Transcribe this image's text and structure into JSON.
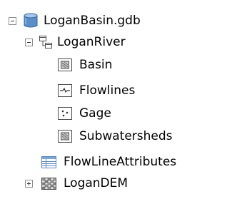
{
  "tree": {
    "root": {
      "label": "LoganBasin.gdb",
      "icon": "database-icon",
      "state": "expanded"
    },
    "dataset": {
      "label": "LoganRiver",
      "icon": "feature-dataset-icon",
      "state": "expanded"
    },
    "feature_classes": [
      {
        "label": "Basin",
        "icon": "polygon-feature-class-icon"
      },
      {
        "label": "Flowlines",
        "icon": "line-feature-class-icon"
      },
      {
        "label": "Gage",
        "icon": "point-feature-class-icon"
      },
      {
        "label": "Subwatersheds",
        "icon": "polygon-feature-class-icon"
      }
    ],
    "table": {
      "label": "FlowLineAttributes",
      "icon": "table-icon"
    },
    "raster": {
      "label": "LoganDEM",
      "icon": "raster-icon",
      "state": "collapsed"
    }
  },
  "colors": {
    "expander_border": "#8c8c8c",
    "database_blue": "#5a8fc8",
    "icon_outline": "#4d4d4d",
    "table_blue": "#7aa6d8"
  }
}
